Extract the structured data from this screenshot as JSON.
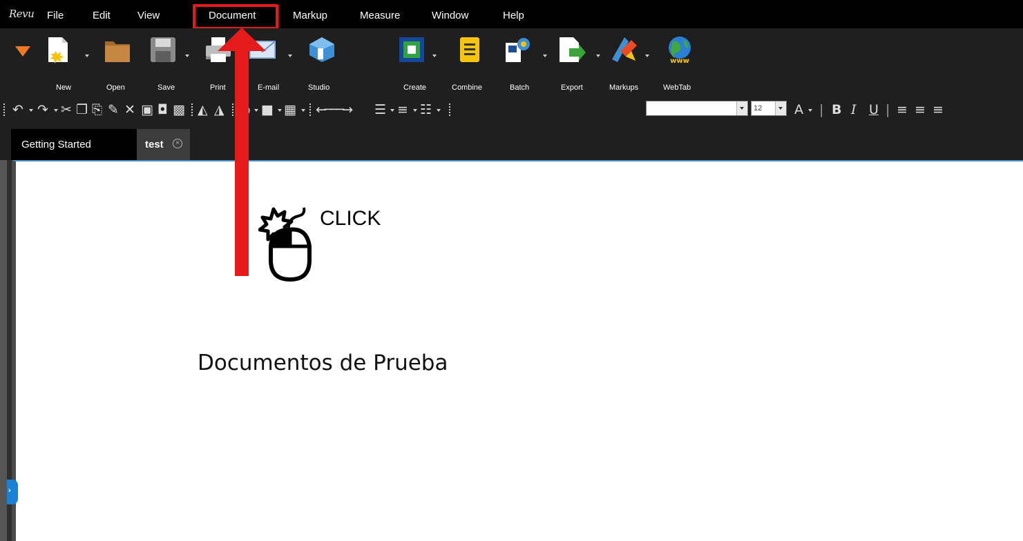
{
  "app": {
    "logo_text": "Revu"
  },
  "menu": {
    "items": [
      "File",
      "Edit",
      "View",
      "Document",
      "Markup",
      "Measure",
      "Window",
      "Help"
    ],
    "highlighted": "Document"
  },
  "toolbar": {
    "buttons": [
      {
        "label": "New",
        "icon": "new-document-icon"
      },
      {
        "label": "Open",
        "icon": "folder-icon"
      },
      {
        "label": "Save",
        "icon": "floppy-disk-icon"
      },
      {
        "label": "Print",
        "icon": "printer-icon"
      },
      {
        "label": "E-mail",
        "icon": "envelope-icon"
      },
      {
        "label": "Studio",
        "icon": "studio-icon"
      },
      {
        "label": "Create",
        "icon": "create-icon"
      },
      {
        "label": "Combine",
        "icon": "combine-icon"
      },
      {
        "label": "Batch",
        "icon": "batch-icon"
      },
      {
        "label": "Export",
        "icon": "export-icon"
      },
      {
        "label": "Markups",
        "icon": "markups-icon"
      },
      {
        "label": "WebTab",
        "icon": "globe-icon"
      }
    ]
  },
  "format": {
    "font_family": "",
    "font_size": "12"
  },
  "tabs": [
    {
      "label": "Getting Started",
      "active": false
    },
    {
      "label": "test",
      "active": true
    }
  ],
  "document": {
    "click_text": "CLICK",
    "heading": "Documentos de Prueba"
  },
  "colors": {
    "menubar": "#000000",
    "toolbar": "#1f1f1f",
    "highlight": "#e51a1a",
    "accent": "#1a82d6"
  }
}
